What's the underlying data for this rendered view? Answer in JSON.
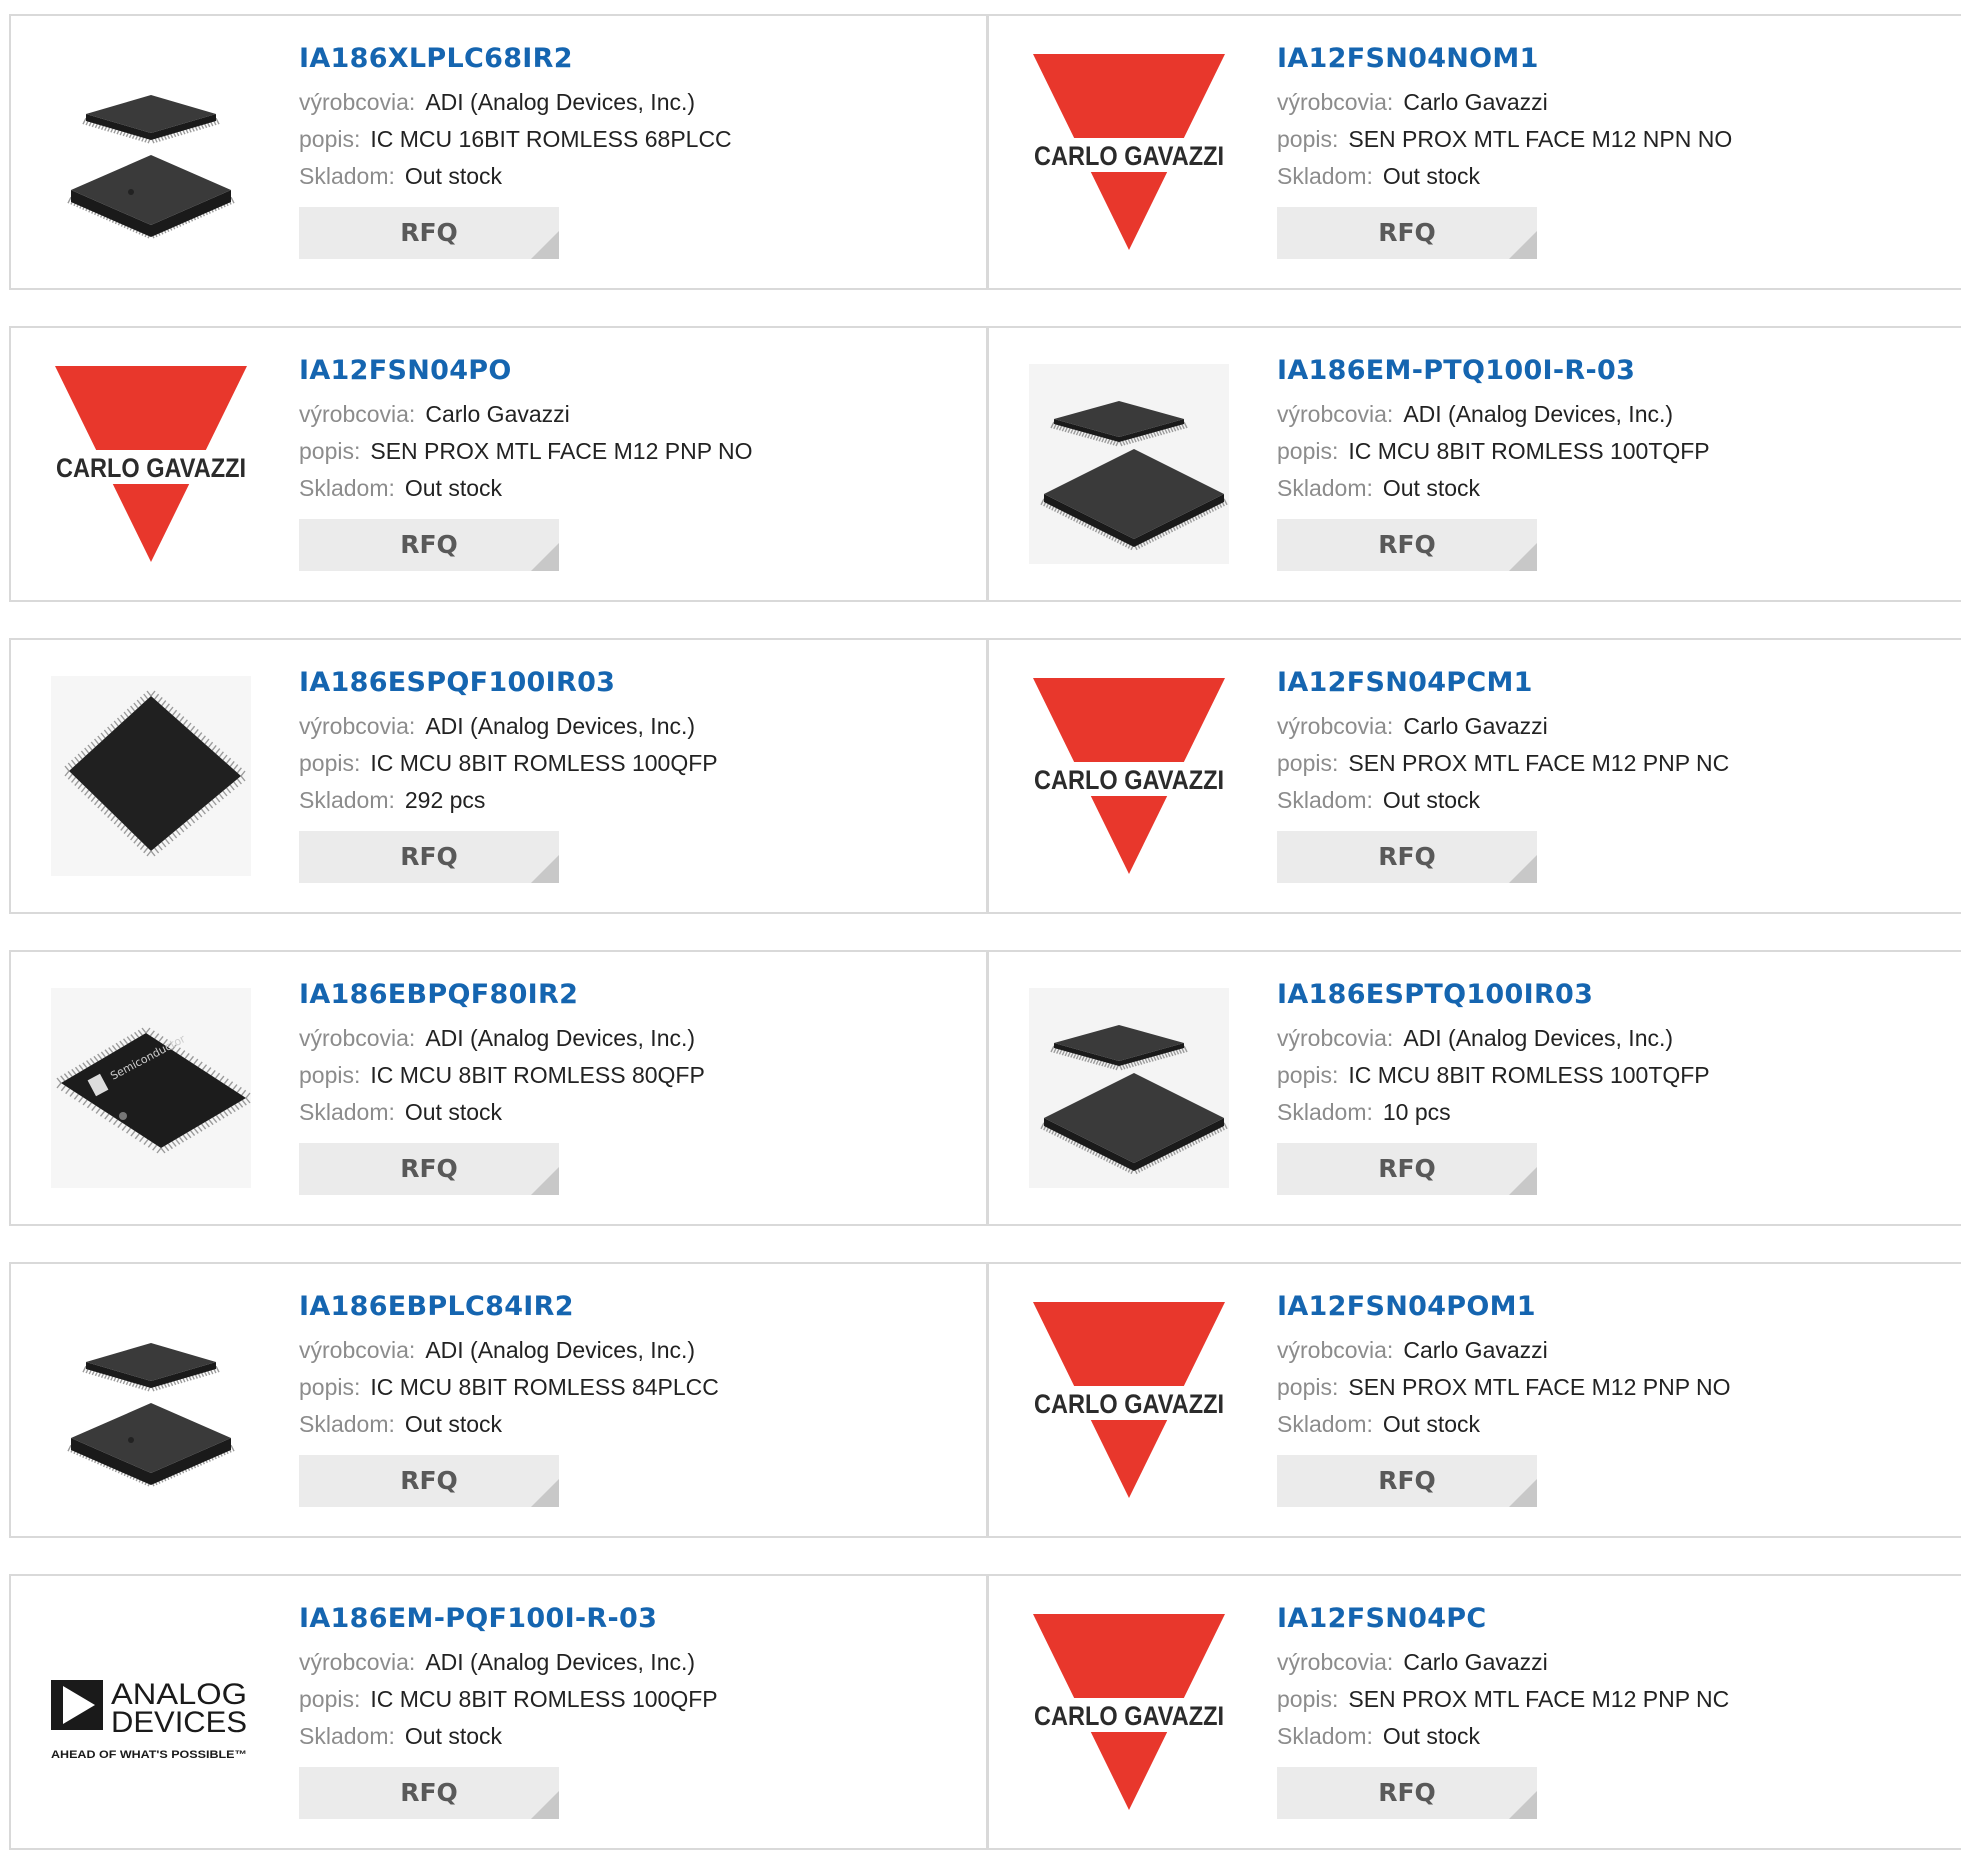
{
  "labels": {
    "manufacturer": "výrobcovia:",
    "description": "popis:",
    "stock": "Skladom:",
    "rfq": "RFQ"
  },
  "colors": {
    "link": "#1565b0",
    "carlo_red": "#e8372c",
    "card_border": "#d9d9d9",
    "button_bg": "#ebebeb"
  },
  "logo_texts": {
    "carlo_gavazzi": "CARLO GAVAZZI",
    "analog_devices_line1": "ANALOG",
    "analog_devices_line2": "DEVICES",
    "analog_devices_tagline": "AHEAD OF WHAT'S POSSIBLE™"
  },
  "products": [
    {
      "part": "IA186XLPLC68IR2",
      "manufacturer": "ADI (Analog Devices, Inc.)",
      "description": "IC MCU 16BIT ROMLESS 68PLCC",
      "stock": "Out stock",
      "image": "chip-plcc-pair"
    },
    {
      "part": "IA12FSN04NOM1",
      "manufacturer": "Carlo Gavazzi",
      "description": "SEN PROX MTL FACE M12 NPN NO",
      "stock": "Out stock",
      "image": "carlo-gavazzi-logo"
    },
    {
      "part": "IA12FSN04PO",
      "manufacturer": "Carlo Gavazzi",
      "description": "SEN PROX MTL FACE M12 PNP NO",
      "stock": "Out stock",
      "image": "carlo-gavazzi-logo"
    },
    {
      "part": "IA186EM-PTQ100I-R-03",
      "manufacturer": "ADI (Analog Devices, Inc.)",
      "description": "IC MCU 8BIT ROMLESS 100TQFP",
      "stock": "Out stock",
      "image": "chip-tqfp-pair"
    },
    {
      "part": "IA186ESPQF100IR03",
      "manufacturer": "ADI (Analog Devices, Inc.)",
      "description": "IC MCU 8BIT ROMLESS 100QFP",
      "stock": "292 pcs",
      "image": "chip-qfp-single"
    },
    {
      "part": "IA12FSN04PCM1",
      "manufacturer": "Carlo Gavazzi",
      "description": "SEN PROX MTL FACE M12 PNP NC",
      "stock": "Out stock",
      "image": "carlo-gavazzi-logo"
    },
    {
      "part": "IA186EBPQF80IR2",
      "manufacturer": "ADI (Analog Devices, Inc.)",
      "description": "IC MCU 8BIT ROMLESS 80QFP",
      "stock": "Out stock",
      "image": "chip-innovasic"
    },
    {
      "part": "IA186ESPTQ100IR03",
      "manufacturer": "ADI (Analog Devices, Inc.)",
      "description": "IC MCU 8BIT ROMLESS 100TQFP",
      "stock": "10 pcs",
      "image": "chip-tqfp-pair"
    },
    {
      "part": "IA186EBPLC84IR2",
      "manufacturer": "ADI (Analog Devices, Inc.)",
      "description": "IC MCU 8BIT ROMLESS 84PLCC",
      "stock": "Out stock",
      "image": "chip-plcc-pair"
    },
    {
      "part": "IA12FSN04POM1",
      "manufacturer": "Carlo Gavazzi",
      "description": "SEN PROX MTL FACE M12 PNP NO",
      "stock": "Out stock",
      "image": "carlo-gavazzi-logo"
    },
    {
      "part": "IA186EM-PQF100I-R-03",
      "manufacturer": "ADI (Analog Devices, Inc.)",
      "description": "IC MCU 8BIT ROMLESS 100QFP",
      "stock": "Out stock",
      "image": "analog-devices-logo"
    },
    {
      "part": "IA12FSN04PC",
      "manufacturer": "Carlo Gavazzi",
      "description": "SEN PROX MTL FACE M12 PNP NC",
      "stock": "Out stock",
      "image": "carlo-gavazzi-logo"
    }
  ]
}
